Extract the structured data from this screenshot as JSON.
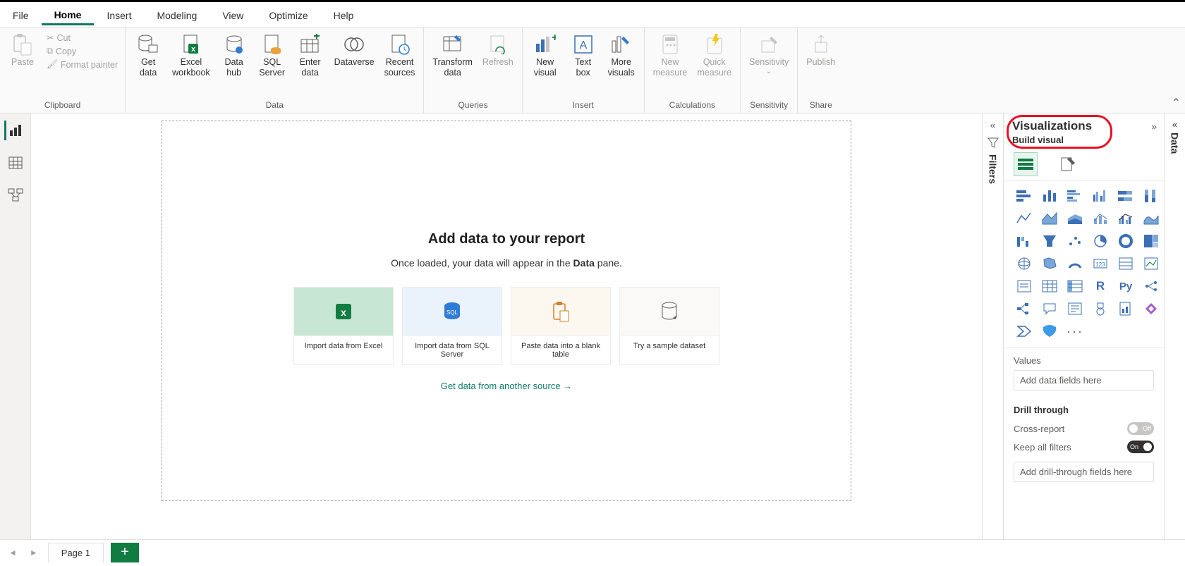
{
  "menu": {
    "items": [
      "File",
      "Home",
      "Insert",
      "Modeling",
      "View",
      "Optimize",
      "Help"
    ],
    "activeIndex": 1
  },
  "ribbon": {
    "clipboard": {
      "paste": "Paste",
      "cut": "Cut",
      "copy": "Copy",
      "format": "Format painter",
      "group": "Clipboard"
    },
    "data": {
      "get": "Get\ndata",
      "excel": "Excel\nworkbook",
      "hub": "Data\nhub",
      "sql": "SQL\nServer",
      "enter": "Enter\ndata",
      "dataverse": "Dataverse",
      "recent": "Recent\nsources",
      "group": "Data"
    },
    "queries": {
      "transform": "Transform\ndata",
      "refresh": "Refresh",
      "group": "Queries"
    },
    "insert": {
      "visual": "New\nvisual",
      "textbox": "Text\nbox",
      "more": "More\nvisuals",
      "group": "Insert"
    },
    "calc": {
      "newm": "New\nmeasure",
      "quick": "Quick\nmeasure",
      "group": "Calculations"
    },
    "sens": {
      "label": "Sensitivity",
      "group": "Sensitivity"
    },
    "share": {
      "publish": "Publish",
      "group": "Share"
    }
  },
  "canvas": {
    "title": "Add data to your report",
    "sub_pre": "Once loaded, your data will appear in the ",
    "sub_bold": "Data",
    "sub_post": " pane.",
    "cards": [
      {
        "label": "Import data from Excel"
      },
      {
        "label": "Import data from SQL Server"
      },
      {
        "label": "Paste data into a blank table"
      },
      {
        "label": "Try a sample dataset"
      }
    ],
    "link": "Get data from another source →"
  },
  "filters": {
    "label": "Filters"
  },
  "vis": {
    "title": "Visualizations",
    "subtitle": "Build visual",
    "values_label": "Values",
    "values_placeholder": "Add data fields here",
    "drill_label": "Drill through",
    "cross": "Cross-report",
    "keep": "Keep all filters",
    "off": "Off",
    "on": "On",
    "drill_placeholder": "Add drill-through fields here"
  },
  "datapane": {
    "label": "Data"
  },
  "footer": {
    "page": "Page 1"
  }
}
